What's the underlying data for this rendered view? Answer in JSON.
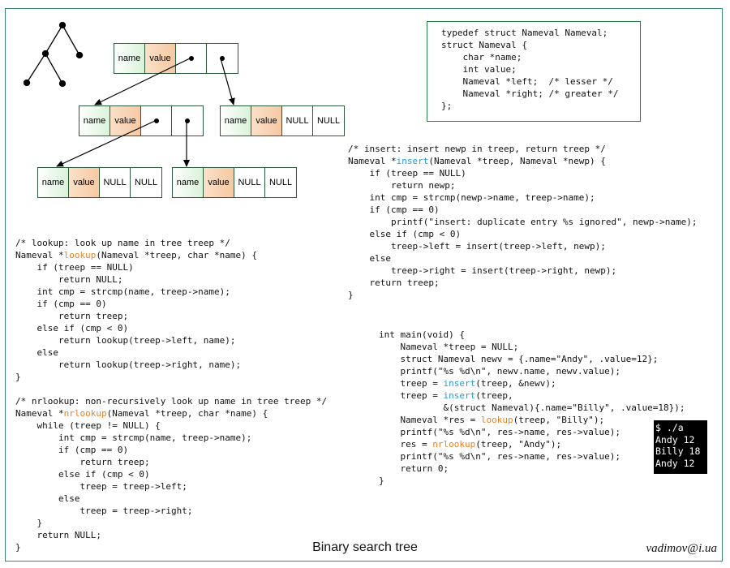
{
  "caption": "Binary search tree",
  "author": "vadimov@i.ua",
  "node_labels": {
    "name": "name",
    "value": "value",
    "null": "NULL"
  },
  "struct_code": "typedef struct Nameval Nameval;\nstruct Nameval {\n    char *name;\n    int value;\n    Nameval *left;  /* lesser */\n    Nameval *right; /* greater */\n};",
  "insert_code": {
    "comment": "/* insert: insert newp in treep, return treep */",
    "sig_pre": "Nameval *",
    "fn": "insert",
    "sig_post": "(Nameval *treep, Nameval *newp) {",
    "body": "    if (treep == NULL)\n        return newp;\n    int cmp = strcmp(newp->name, treep->name);\n    if (cmp == 0)\n        printf(\"insert: duplicate entry %s ignored\", newp->name);\n    else if (cmp < 0)\n        treep->left = insert(treep->left, newp);\n    else\n        treep->right = insert(treep->right, newp);\n    return treep;\n}"
  },
  "lookup_code": {
    "comment": "/* lookup: look up name in tree treep */",
    "sig_pre": "Nameval *",
    "fn": "lookup",
    "sig_post": "(Nameval *treep, char *name) {",
    "body": "    if (treep == NULL)\n        return NULL;\n    int cmp = strcmp(name, treep->name);\n    if (cmp == 0)\n        return treep;\n    else if (cmp < 0)\n        return lookup(treep->left, name);\n    else\n        return lookup(treep->right, name);\n}"
  },
  "nrlookup_code": {
    "comment": "/* nrlookup: non-recursively look up name in tree treep */",
    "sig_pre": "Nameval *",
    "fn": "nrlookup",
    "sig_post": "(Nameval *treep, char *name) {",
    "body": "    while (treep != NULL) {\n        int cmp = strcmp(name, treep->name);\n        if (cmp == 0)\n            return treep;\n        else if (cmp < 0)\n            treep = treep->left;\n        else\n            treep = treep->right;\n    }\n    return NULL;\n}"
  },
  "main_code": {
    "l1": "int main(void) {",
    "l2": "    Nameval *treep = NULL;",
    "l3": "    struct Nameval newv = {.name=\"Andy\", .value=12};",
    "l4": "    printf(\"%s %d\\n\", newv.name, newv.value);",
    "l5_pre": "    treep = ",
    "l5_fn": "insert",
    "l5_post": "(treep, &newv);",
    "l6_pre": "    treep = ",
    "l6_fn": "insert",
    "l6_post": "(treep,",
    "l7": "            &(struct Nameval){.name=\"Billy\", .value=18});",
    "l8_pre": "    Nameval *res = ",
    "l8_fn": "lookup",
    "l8_post": "(treep, \"Billy\");",
    "l9": "    printf(\"%s %d\\n\", res->name, res->value);",
    "l10_pre": "    res = ",
    "l10_fn": "nrlookup",
    "l10_post": "(treep, \"Andy\");",
    "l11": "    printf(\"%s %d\\n\", res->name, res->value);",
    "l12": "    return 0;",
    "l13": "}"
  },
  "terminal_output": "$ ./a\nAndy 12\nBilly 18\nAndy 12",
  "colors": {
    "frame": "#3a8a6a",
    "function_highlight_orange": "#e8822a",
    "function_highlight_blue": "#2a9ad8",
    "name_cell": "#d9f2d9",
    "value_cell": "#f6c9a3"
  }
}
